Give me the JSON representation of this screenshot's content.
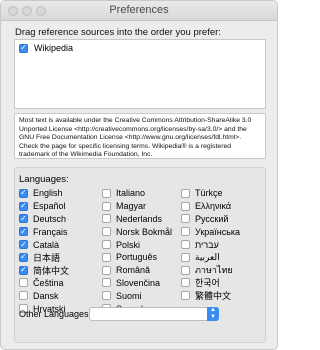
{
  "window": {
    "title": "Preferences"
  },
  "sources": {
    "instruction": "Drag reference sources into the order you prefer:",
    "items": [
      {
        "label": "Wikipedia",
        "checked": true
      }
    ]
  },
  "license": {
    "text": "Most text is available under the Creative Commons Attribution-ShareAlike 3.0 Unported License <http://creativecommons.org/licenses/by-sa/3.0/> and the GNU Free Documentation License <http://www.gnu.org/licenses/fdl.html>. Check the page for specific licensing terms. Wikipedia® is a registered trademark of the Wikimedia Foundation, Inc."
  },
  "languages": {
    "title": "Languages:",
    "columns": [
      [
        {
          "label": "English",
          "checked": true
        },
        {
          "label": "Español",
          "checked": true
        },
        {
          "label": "Deutsch",
          "checked": true
        },
        {
          "label": "Français",
          "checked": true
        },
        {
          "label": "Català",
          "checked": true
        },
        {
          "label": "日本語",
          "checked": true
        },
        {
          "label": "简体中文",
          "checked": true
        },
        {
          "label": "Čeština",
          "checked": false
        },
        {
          "label": "Dansk",
          "checked": false
        },
        {
          "label": "Hrvatski",
          "checked": false
        }
      ],
      [
        {
          "label": "Italiano",
          "checked": false
        },
        {
          "label": "Magyar",
          "checked": false
        },
        {
          "label": "Nederlands",
          "checked": false
        },
        {
          "label": "Norsk Bokmål",
          "checked": false
        },
        {
          "label": "Polski",
          "checked": false
        },
        {
          "label": "Português",
          "checked": false
        },
        {
          "label": "Română",
          "checked": false
        },
        {
          "label": "Slovenčina",
          "checked": false
        },
        {
          "label": "Suomi",
          "checked": false
        },
        {
          "label": "Svenska",
          "checked": false
        }
      ],
      [
        {
          "label": "Türkçe",
          "checked": false
        },
        {
          "label": "Ελληνικά",
          "checked": false
        },
        {
          "label": "Русский",
          "checked": false
        },
        {
          "label": "Українська",
          "checked": false
        },
        {
          "label": "עברית",
          "checked": false
        },
        {
          "label": "العربية",
          "checked": false
        },
        {
          "label": "ภาษาไทย",
          "checked": false
        },
        {
          "label": "한국어",
          "checked": false
        },
        {
          "label": "繁體中文",
          "checked": false
        }
      ]
    ],
    "other_label": "Other Languages:",
    "other_value": ""
  },
  "colors": {
    "accent": "#3a8cf2"
  }
}
